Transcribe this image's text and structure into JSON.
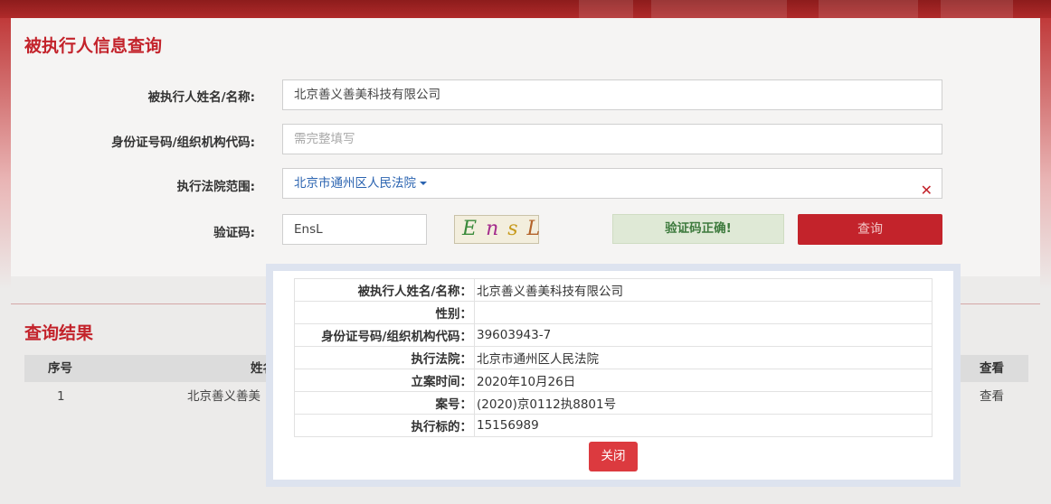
{
  "query": {
    "title": "被执行人信息查询",
    "name_label": "被执行人姓名/名称:",
    "name_value": "北京善义善美科技有限公司",
    "id_label": "身份证号码/组织机构代码:",
    "id_placeholder": "需完整填写",
    "court_label": "执行法院范围:",
    "court_value": "北京市通州区人民法院",
    "captcha_label": "验证码:",
    "captcha_value": "EnsL",
    "captcha_chars": [
      "E",
      "n",
      "s",
      "L"
    ],
    "verify_status": "验证码正确!",
    "submit_label": "查询",
    "clear_symbol": "✕"
  },
  "result": {
    "title": "查询结果",
    "columns": [
      "序号",
      "姓名",
      "查看"
    ],
    "rows": [
      {
        "index": "1",
        "name": "北京善义善美",
        "action": "查看"
      }
    ]
  },
  "modal": {
    "rows": [
      {
        "label": "被执行人姓名/名称：",
        "value": "北京善义善美科技有限公司"
      },
      {
        "label": "性别：",
        "value": ""
      },
      {
        "label": "身份证号码/组织机构代码：",
        "value": "39603943-7"
      },
      {
        "label": "执行法院：",
        "value": "北京市通州区人民法院"
      },
      {
        "label": "立案时间：",
        "value": "2020年10月26日"
      },
      {
        "label": "案号：",
        "value": "(2020)京0112执8801号"
      },
      {
        "label": "执行标的：",
        "value": "15156989"
      }
    ],
    "close_label": "关闭"
  },
  "colors": {
    "accent": "#c3232b",
    "link": "#2a63b0",
    "success_bg": "#dfe9d6",
    "close_button": "#dc3a3f"
  }
}
